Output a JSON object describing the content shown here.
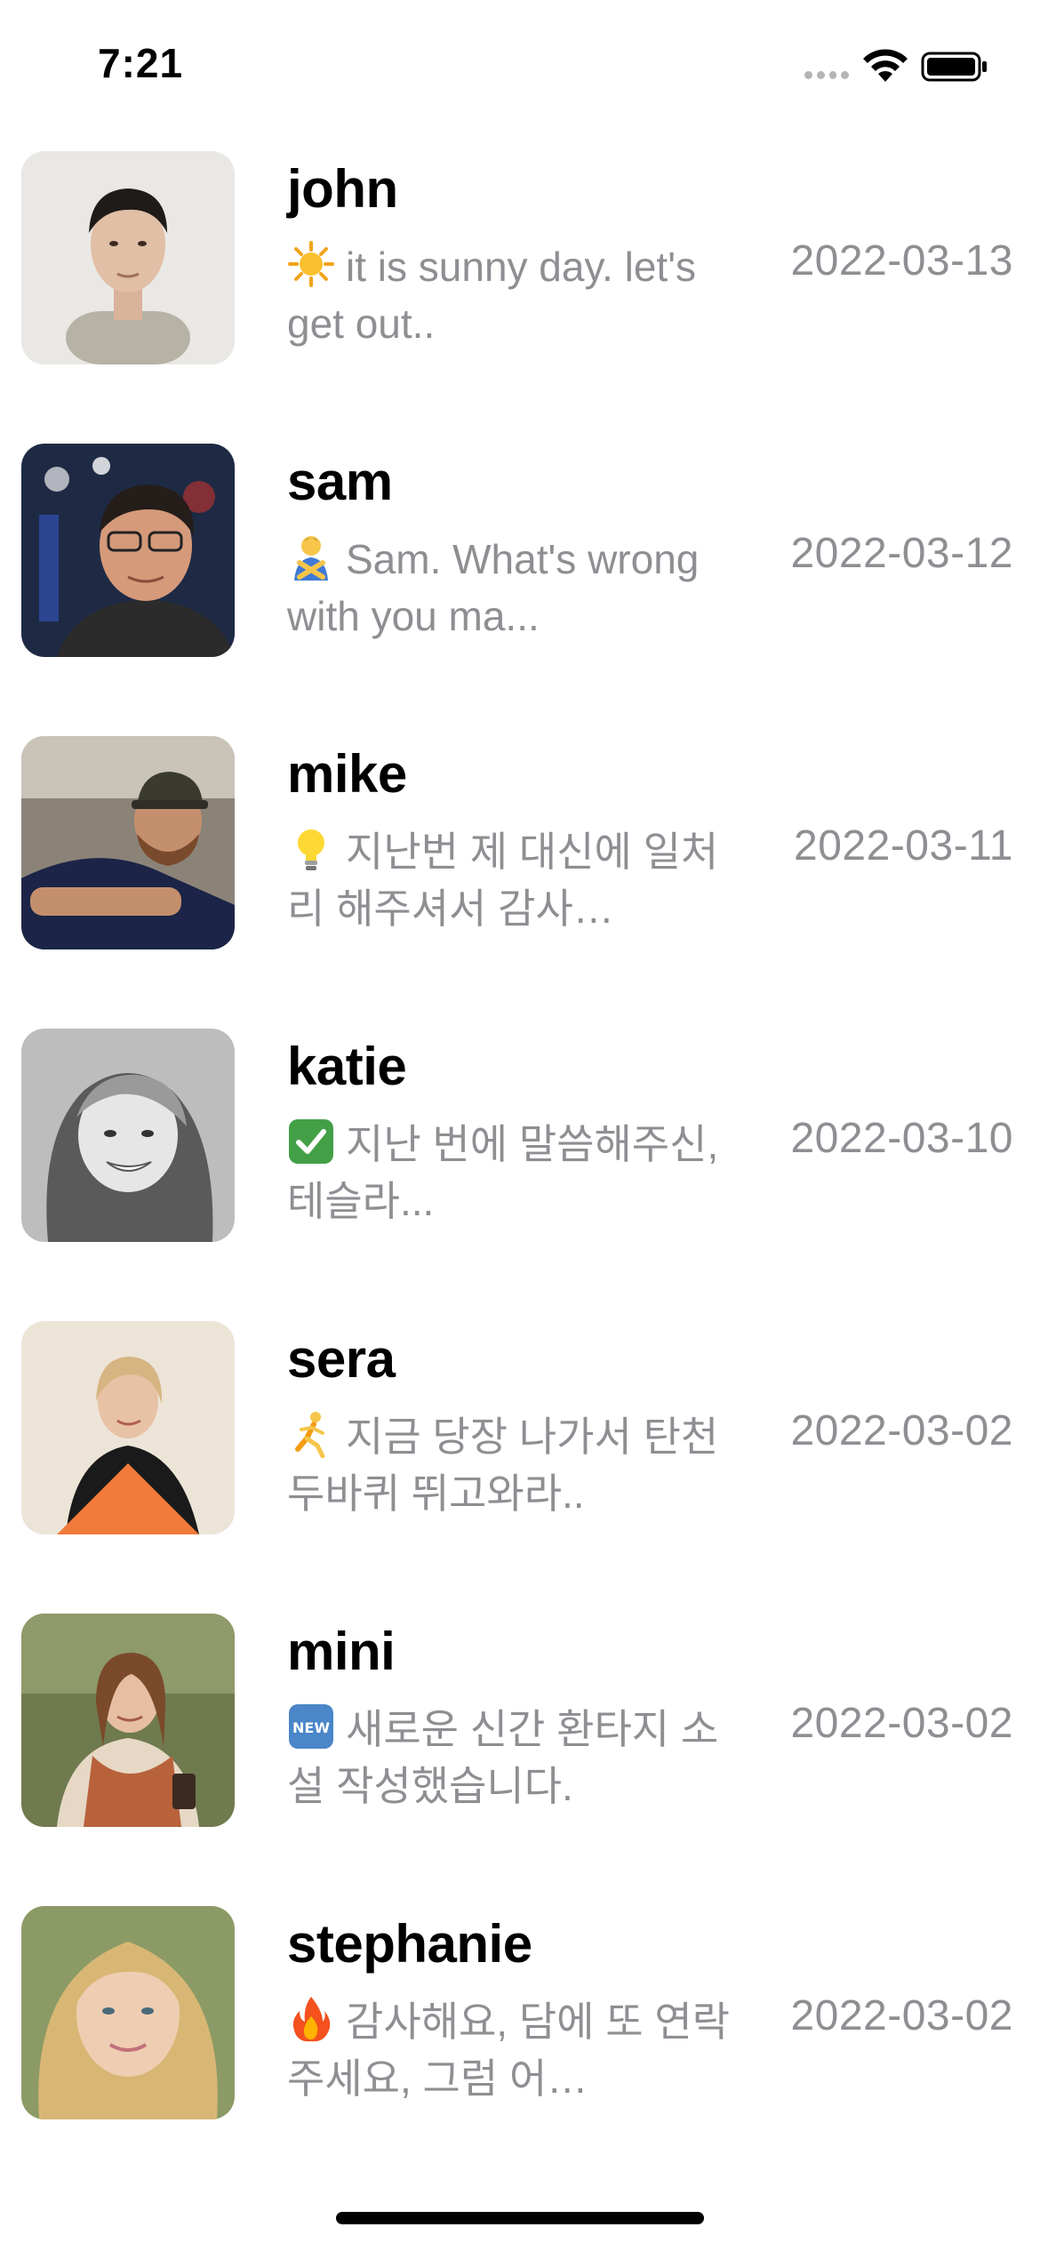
{
  "status_bar": {
    "time": "7:21"
  },
  "chats": [
    {
      "name": "john",
      "emoji": "sun-icon",
      "preview": "it is sunny day. let's get out..",
      "date": "2022-03-13",
      "avatar_bg": "#e9e7e3"
    },
    {
      "name": "sam",
      "emoji": "person-crossing-arms-icon",
      "preview": "Sam. What's wrong with you ma...",
      "date": "2022-03-12",
      "avatar_bg": "#2a3550"
    },
    {
      "name": "mike",
      "emoji": "lightbulb-icon",
      "preview": "지난번 제 대신에 일처리 해주셔서 감사…",
      "date": "2022-03-11",
      "avatar_bg": "#6d6358"
    },
    {
      "name": "katie",
      "emoji": "check-mark-button-icon",
      "preview": "지난 번에 말씀해주신, 테슬라...",
      "date": "2022-03-10",
      "avatar_bg": "#9a9a9a"
    },
    {
      "name": "sera",
      "emoji": "person-running-icon",
      "preview": "지금 당장 나가서 탄천 두바퀴 뛰고와라..",
      "date": "2022-03-02",
      "avatar_bg": "#ede4d8"
    },
    {
      "name": "mini",
      "emoji": "new-button-icon",
      "preview": "새로운 신간 환타지 소설 작성했습니다.",
      "date": "2022-03-02",
      "avatar_bg": "#6f7a4e"
    },
    {
      "name": "stephanie",
      "emoji": "fire-icon",
      "preview": "감사해요, 담에 또 연락주세요, 그럼 어…",
      "date": "2022-03-02",
      "avatar_bg": "#8c9a66"
    }
  ]
}
